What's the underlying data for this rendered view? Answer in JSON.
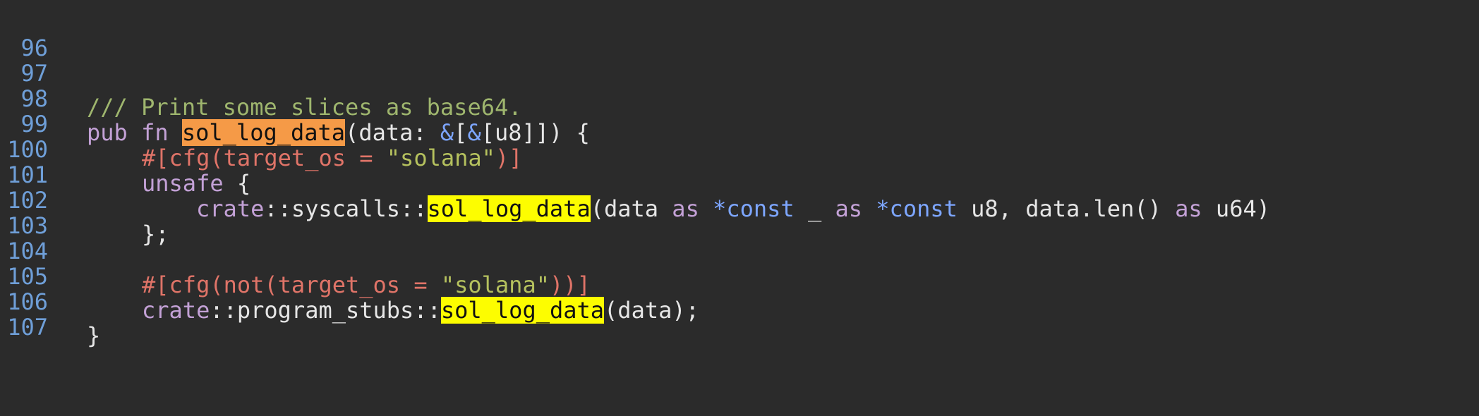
{
  "editor": {
    "line_numbers": [
      "96",
      "97",
      "98",
      "99",
      "100",
      "101",
      "102",
      "103",
      "104",
      "105",
      "106",
      "107"
    ],
    "tokens": {
      "l97_comment": "/// Print some slices as base64.",
      "l98_pub": "pub",
      "l98_fn": "fn",
      "l98_name": "sol_log_data",
      "l98_open": "(data: ",
      "l98_amp1": "&",
      "l98_bracket1": "[",
      "l98_amp2": "&",
      "l98_rest": "[u8]]) {",
      "l99_attr_open": "#[cfg(target_os = ",
      "l99_str": "\"solana\"",
      "l99_attr_close": ")]",
      "l100_unsafe": "unsafe",
      "l100_brace": " {",
      "l101_crate": "crate",
      "l101_path": "::syscalls::",
      "l101_name": "sol_log_data",
      "l101_args1": "(data ",
      "l101_as1": "as",
      "l101_ptr1": "*const",
      "l101_mid1": " _ ",
      "l101_as2": "as",
      "l101_ptr2": "*const",
      "l101_mid2": " u8, data.len() ",
      "l101_as3": "as",
      "l101_end": " u64)",
      "l102_close": "};",
      "l104_attr_open": "#[cfg(not(target_os = ",
      "l104_str": "\"solana\"",
      "l104_attr_close": "))]",
      "l105_crate": "crate",
      "l105_path": "::program_stubs::",
      "l105_name": "sol_log_data",
      "l105_end": "(data);",
      "l106_close": "}"
    }
  },
  "colors": {
    "background": "#2b2b2b",
    "line_number": "#6f9fd8",
    "comment": "#9fb66e",
    "keyword": "#c3a1d6",
    "attribute": "#e07468",
    "string": "#b5c15e",
    "highlight_primary": "#f59a47",
    "highlight_match": "#fdfd00"
  }
}
